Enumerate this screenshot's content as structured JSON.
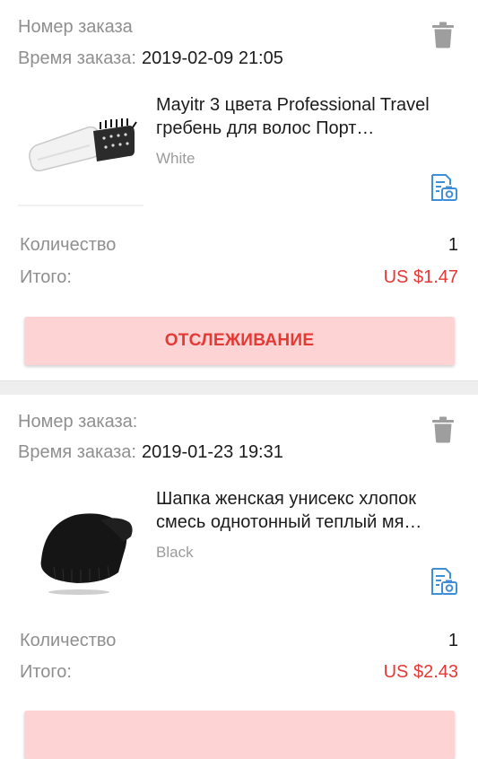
{
  "orders": [
    {
      "order_number_label": "Номер заказа",
      "order_time_label": "Время заказа:",
      "order_time": "2019-02-09 21:05",
      "product": {
        "title": "Mayitr 3 цвета Professional Travel гребень для волос Порт…",
        "variant": "White",
        "image_icon": "hairbrush-image"
      },
      "quantity_label": "Количество",
      "quantity": "1",
      "total_label": "Итого:",
      "total": "US $1.47",
      "track_button": "ОТСЛЕЖИВАНИЕ"
    },
    {
      "order_number_label": "Номер заказа:",
      "order_time_label": "Время заказа:",
      "order_time": "2019-01-23 19:31",
      "product": {
        "title": "Шапка женская унисекс хлопок смесь однотонный теплый мя…",
        "variant": "Black",
        "image_icon": "beanie-image"
      },
      "quantity_label": "Количество",
      "quantity": "1",
      "total_label": "Итого:",
      "total": "US $2.43",
      "track_button": ""
    }
  ],
  "colors": {
    "price": "#e53935",
    "button_bg": "#fdd3d3",
    "label_gray": "#8f8f8f",
    "icon_blue": "#3f8fd8",
    "separator": "#eeeeee"
  },
  "icons": {
    "delete": "trash-icon",
    "review_photo": "review-photo-icon"
  }
}
